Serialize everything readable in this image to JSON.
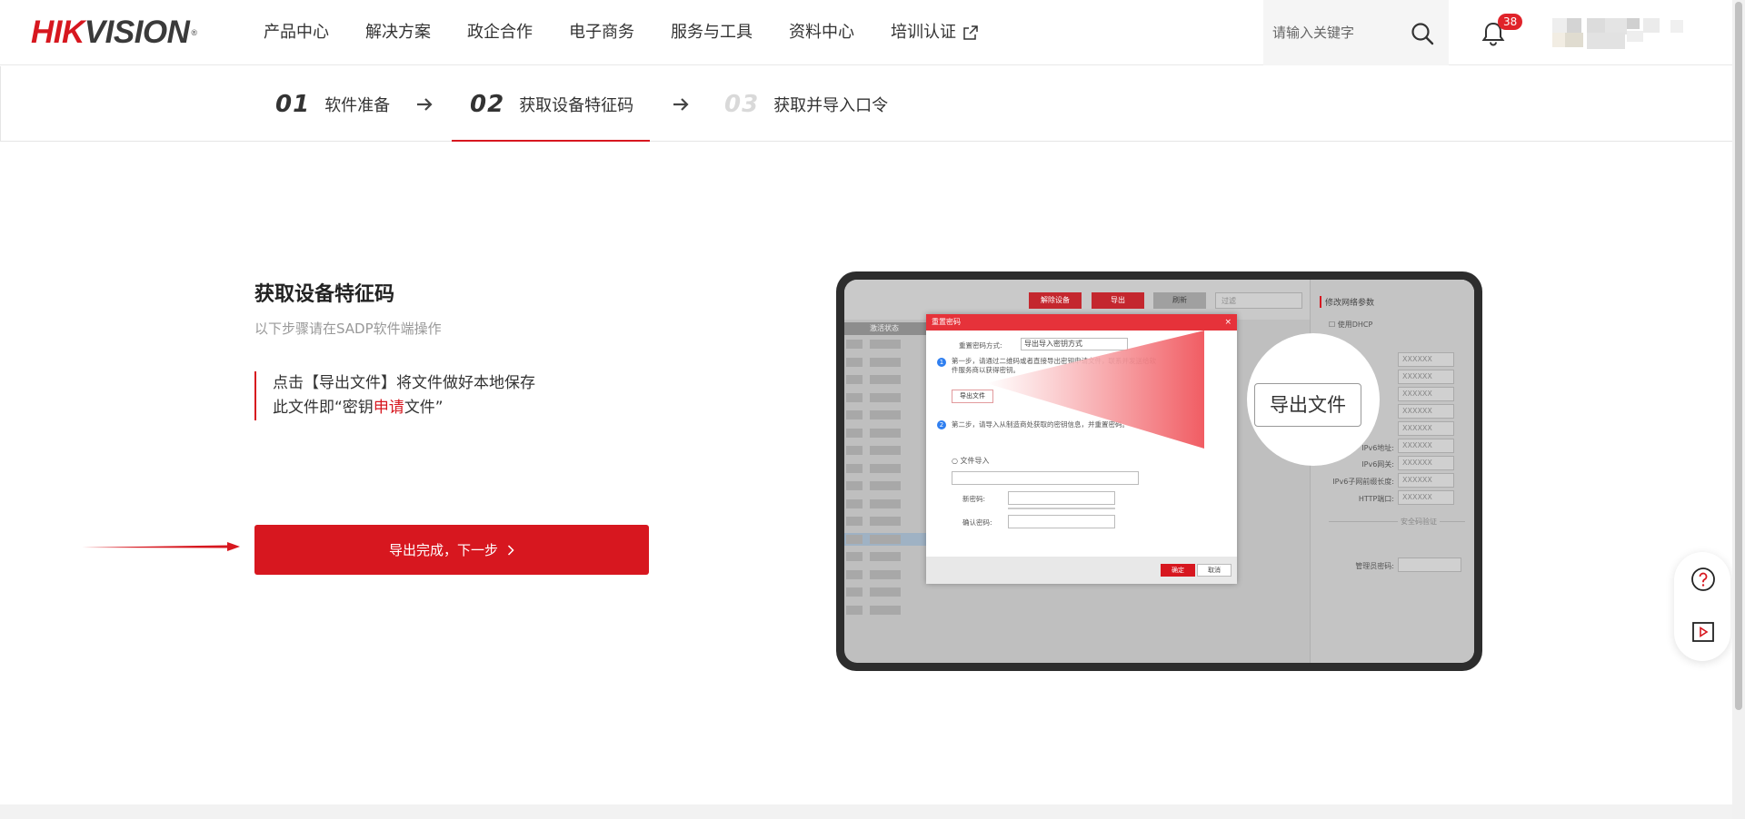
{
  "brand": {
    "logo_red": "HIK",
    "logo_dark": "VISION",
    "logo_reg": "®",
    "accent": "#d7171f"
  },
  "nav": {
    "items": [
      "产品中心",
      "解决方案",
      "政企合作",
      "电子商务",
      "服务与工具",
      "资料中心",
      "培训认证"
    ]
  },
  "search": {
    "placeholder": "请输入关键字"
  },
  "notifications": {
    "count": "38"
  },
  "steps": [
    {
      "num": "01",
      "label": "软件准备",
      "state": "done"
    },
    {
      "num": "02",
      "label": "获取设备特征码",
      "state": "active"
    },
    {
      "num": "03",
      "label": "获取并导入口令",
      "state": "disabled"
    }
  ],
  "main": {
    "title": "获取设备特征码",
    "subtitle": "以下步骤请在SADP软件端操作",
    "instruction_line1": "点击【导出文件】将文件做好本地保存",
    "instruction_line2_pre": "此文件即“密钥",
    "instruction_line2_red": "申请",
    "instruction_line2_post": "文件”",
    "next_button": "导出完成，下一步"
  },
  "illustration": {
    "top_buttons": [
      "解除设备",
      "导出",
      "刷新"
    ],
    "search_placeholder": "过滤",
    "column_header": "激活状态",
    "right_title": "修改网络参数",
    "right_dhcp": "使用DHCP",
    "right_labels": [
      "IPv6地址:",
      "IPv6网关:",
      "IPv6子网前缀长度:",
      "HTTP端口:"
    ],
    "right_field_value": "XXXXXX",
    "right_divider": "安全码验证",
    "right_admin": "管理员密码:",
    "dialog": {
      "title": "重置密码",
      "close": "×",
      "mode_label": "重置密码方式:",
      "mode_value": "导出导入密钥方式",
      "step1": "第一步，请通过二维码或者直接导出密钥申请文件，联系并发送给软件服务商以获得密钥。",
      "export_button": "导出文件",
      "step2": "第二步，请导入从制造商处获取的密钥信息，并重置密码。",
      "file_import": "文件导入",
      "new_pwd": "新密码:",
      "confirm_pwd": "确认密码:",
      "ok": "确定",
      "cancel": "取消"
    },
    "zoom_label": "导出文件"
  }
}
